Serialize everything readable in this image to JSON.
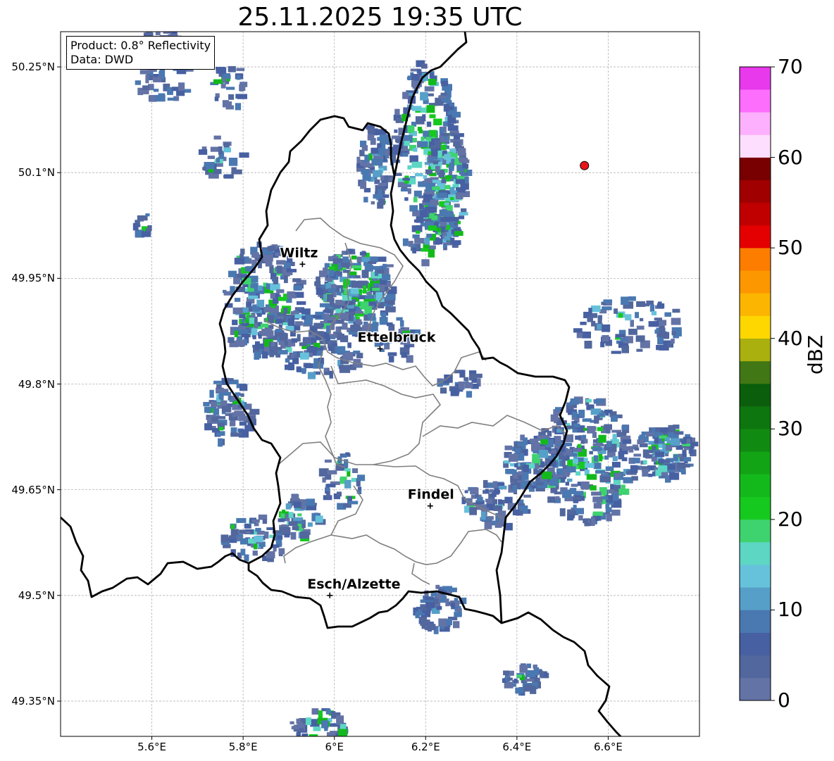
{
  "title": "25.11.2025 19:35 UTC",
  "info_box": {
    "line1": "Product: 0.8° Reflectivity",
    "line2": "Data: DWD"
  },
  "axes": {
    "lat_labels": [
      "50.25°N",
      "50.1°N",
      "49.95°N",
      "49.8°N",
      "49.65°N",
      "49.5°N",
      "49.35°N"
    ],
    "lon_labels": [
      "5.6°E",
      "5.8°E",
      "6°E",
      "6.2°E",
      "6.4°E",
      "6.6°E"
    ],
    "lat_values": [
      50.25,
      50.1,
      49.95,
      49.8,
      49.65,
      49.5,
      49.35
    ],
    "lon_values": [
      5.6,
      5.8,
      6.0,
      6.2,
      6.4,
      6.6
    ],
    "lat_range": [
      49.3,
      50.3
    ],
    "lon_range": [
      5.4,
      6.8
    ],
    "grid": true
  },
  "cities": [
    {
      "name": "Wiltz",
      "lon": 5.93,
      "lat": 49.97
    },
    {
      "name": "Ettelbruck",
      "lon": 6.1,
      "lat": 49.85
    },
    {
      "name": "Findel",
      "lon": 6.21,
      "lat": 49.627
    },
    {
      "name": "Esch/Alzette",
      "lon": 5.99,
      "lat": 49.5
    }
  ],
  "radar_site_marker": {
    "lon": 6.548,
    "lat": 50.11,
    "color": "#e8161b"
  },
  "colorbar": {
    "label": "dBZ",
    "ticks": [
      "0",
      "10",
      "20",
      "30",
      "40",
      "50",
      "60",
      "70"
    ],
    "range": [
      0,
      70
    ],
    "colors": [
      "#6373a6",
      "#52679d",
      "#4760a2",
      "#4a78b1",
      "#569fc8",
      "#66c2db",
      "#5dd6c4",
      "#3ed36e",
      "#16c91e",
      "#13b91b",
      "#12a414",
      "#118a12",
      "#0d760e",
      "#0b5e0b",
      "#417714",
      "#aab00e",
      "#fed600",
      "#fcb500",
      "#fd9700",
      "#fd7d00",
      "#e40000",
      "#c00000",
      "#a00000",
      "#780000",
      "#fedefe",
      "#fdb0fe",
      "#fd6efd",
      "#e839ec"
    ]
  },
  "colors": {
    "border": "#000000",
    "districts": "#7f7f7f",
    "grid": "#b4b4b4"
  }
}
